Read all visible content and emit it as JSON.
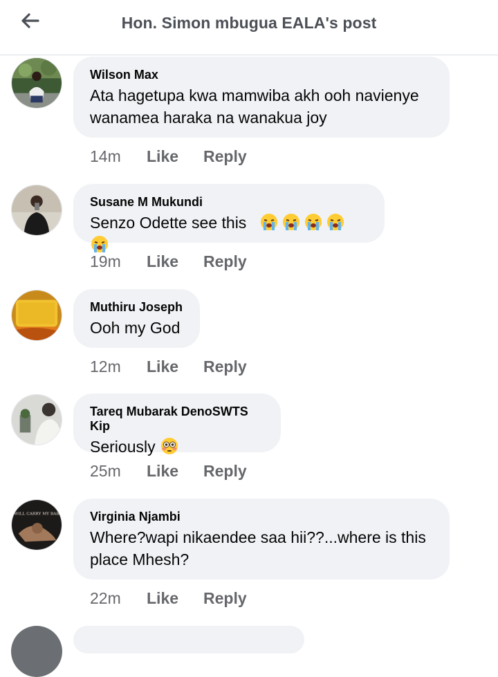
{
  "header": {
    "title": "Hon. Simon mbugua EALA's post",
    "back_icon": "arrow-left-icon"
  },
  "colors": {
    "bubble": "#f0f2f5",
    "meta_text": "#65676b",
    "title_text": "#4b4f56"
  },
  "comments": [
    {
      "author": "Wilson Max",
      "text": "Ata hagetupa kwa mamwiba akh ooh navienye wanamea haraka na wanakua joy",
      "time": "14m",
      "like_label": "Like",
      "reply_label": "Reply"
    },
    {
      "author": "Susane M Mukundi",
      "text": "Senzo Odette see this",
      "emojis": [
        "loudly-crying-face",
        "loudly-crying-face",
        "loudly-crying-face",
        "loudly-crying-face",
        "loudly-crying-face"
      ],
      "time": "19m",
      "like_label": "Like",
      "reply_label": "Reply"
    },
    {
      "author": "Muthiru Joseph",
      "text": "Ooh my God",
      "time": "12m",
      "like_label": "Like",
      "reply_label": "Reply"
    },
    {
      "author": "Tareq Mubarak DenoSWTS Kip",
      "text": "Seriously",
      "emojis": [
        "flushed-face"
      ],
      "time": "25m",
      "like_label": "Like",
      "reply_label": "Reply"
    },
    {
      "author": "Virginia Njambi",
      "text": "Where?wapi nikaendee saa hii??...where is this place Mhesh?",
      "avatar_text": "WILL CARRY MY BAB",
      "time": "22m",
      "like_label": "Like",
      "reply_label": "Reply"
    }
  ]
}
